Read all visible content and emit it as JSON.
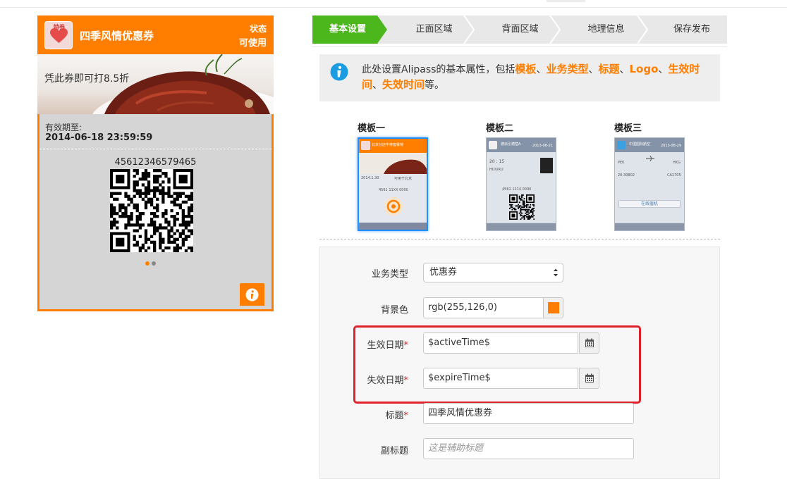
{
  "pass": {
    "title": "四季风情优惠券",
    "logo_text": "特券",
    "status_label": "状态",
    "status_value": "可使用",
    "strip_text": "凭此券即可打8.5折",
    "valid_label": "有效期至:",
    "valid_value": "2014-06-18 23:59:59",
    "code": "45612346579465",
    "accent_color": "#ff7e00",
    "icons": {
      "info": "info-icon"
    }
  },
  "steps": {
    "active_index": 0,
    "items": [
      "基本设置",
      "正面区域",
      "背面区域",
      "地理信息",
      "保存发布"
    ],
    "active_color": "#4cb61d"
  },
  "info": {
    "prefix": "此处设置Alipass的基本属性，包括",
    "k1": "模板",
    "sep1": "、",
    "k2": "业务类型",
    "sep2": "、",
    "k3": "标题",
    "sep3": "、",
    "k4": "Logo",
    "sep4": "、",
    "k5": "生效时间",
    "sep5": "、",
    "k6": "失效时间",
    "suffix": "等。"
  },
  "templates": [
    {
      "name": "模板一",
      "selected": true,
      "head_text": "北京分店牛排套餐特",
      "date": "",
      "lines": [
        "2014.1.30",
        "可用于北京",
        "4561 11XX 0000"
      ]
    },
    {
      "name": "模板二",
      "selected": false,
      "head_text": "德派引德营A",
      "date": "2013-08-21",
      "lines": [
        "20 : 15",
        "HUIURU",
        "4561 1214 0000"
      ]
    },
    {
      "name": "模板三",
      "selected": false,
      "head_text": "中国国际航空",
      "date": "2013-08-29",
      "lines": [
        "PEK",
        "HKG",
        "20:30802",
        "CA1705",
        "在线值机"
      ]
    }
  ],
  "form": {
    "business_type": {
      "label": "业务类型",
      "value": "优惠券"
    },
    "bg_color": {
      "label": "背景色",
      "value": "rgb(255,126,0)",
      "swatch": "#ff7e00"
    },
    "active_date": {
      "label": "生效日期",
      "required": "*",
      "value": "$activeTime$"
    },
    "expire_date": {
      "label": "失效日期",
      "required": "*",
      "value": "$expireTime$"
    },
    "title": {
      "label": "标题",
      "required": "*",
      "value": "四季风情优惠券"
    },
    "subtitle": {
      "label": "副标题",
      "placeholder": "这是辅助标题"
    },
    "icons": {
      "calendar": "calendar-icon",
      "dropdown": "chevron-updown-icon"
    }
  }
}
